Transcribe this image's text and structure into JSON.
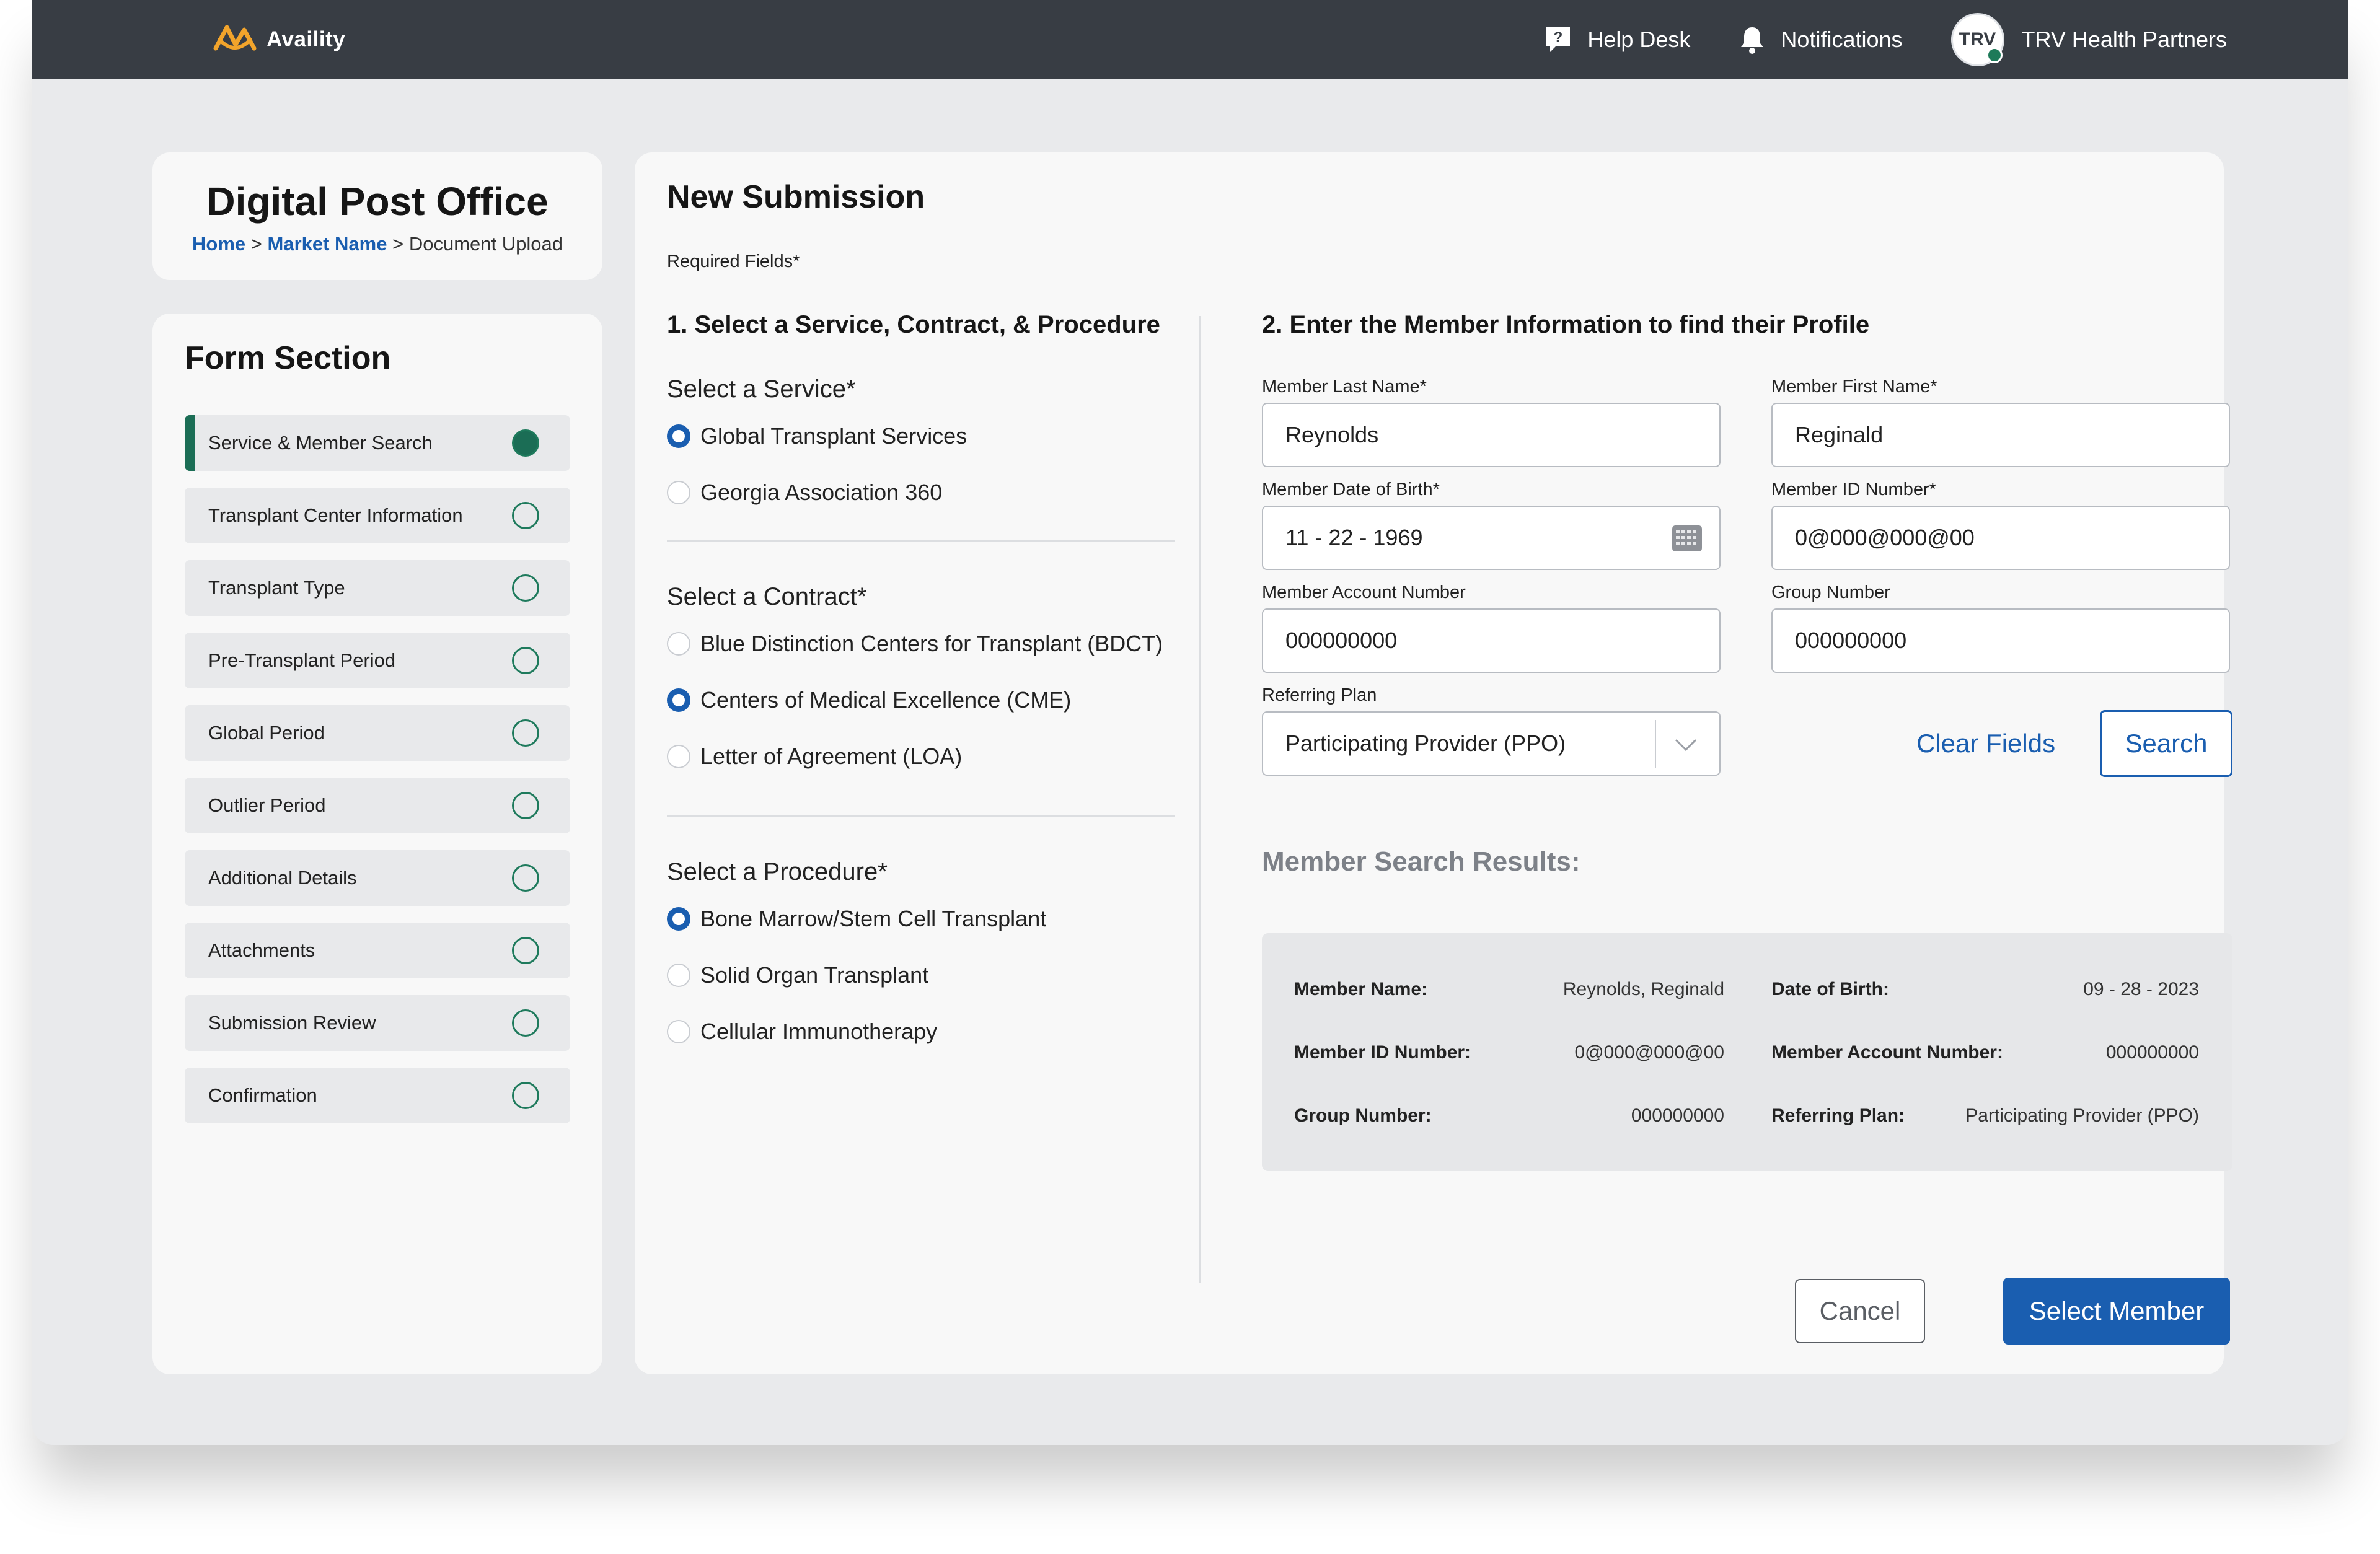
{
  "header": {
    "brand": "Availity",
    "help_desk": "Help Desk",
    "notifications": "Notifications",
    "avatar_initials": "TRV",
    "org_name": "TRV Health Partners"
  },
  "title_card": {
    "title": "Digital Post Office",
    "breadcrumb": {
      "home": "Home",
      "market": "Market Name",
      "current": "Document Upload",
      "separator": ">"
    }
  },
  "sidebar": {
    "title": "Form Section",
    "steps": [
      {
        "label": "Service & Member Search",
        "active": true
      },
      {
        "label": "Transplant Center Information"
      },
      {
        "label": "Transplant Type"
      },
      {
        "label": "Pre-Transplant Period"
      },
      {
        "label": "Global Period"
      },
      {
        "label": "Outlier Period"
      },
      {
        "label": "Additional Details"
      },
      {
        "label": "Attachments"
      },
      {
        "label": "Submission Review"
      },
      {
        "label": "Confirmation"
      }
    ]
  },
  "main": {
    "title": "New Submission",
    "required_note": "Required Fields*",
    "section1": {
      "heading": "1. Select a Service, Contract, & Procedure",
      "service": {
        "title": "Select a Service*",
        "options": [
          "Global Transplant Services",
          "Georgia Association 360"
        ],
        "selected": 0
      },
      "contract": {
        "title": "Select a Contract*",
        "options": [
          "Blue Distinction Centers for Transplant (BDCT)",
          "Centers of Medical Excellence (CME)",
          "Letter of Agreement (LOA)"
        ],
        "selected": 1
      },
      "procedure": {
        "title": "Select a Procedure*",
        "options": [
          "Bone Marrow/Stem Cell Transplant",
          "Solid Organ Transplant",
          "Cellular Immunotherapy"
        ],
        "selected": 0
      }
    },
    "section2": {
      "heading": "2. Enter the Member Information to find their Profile",
      "last_name": {
        "label": "Member Last Name*",
        "value": "Reynolds"
      },
      "first_name": {
        "label": "Member First Name*",
        "value": "Reginald"
      },
      "dob": {
        "label": "Member Date of Birth*",
        "value": "11 - 22 - 1969"
      },
      "member_id": {
        "label": "Member ID Number*",
        "value": "0@000@000@00"
      },
      "account_number": {
        "label": "Member Account Number",
        "value": "000000000"
      },
      "group_number": {
        "label": "Group Number",
        "value": "000000000"
      },
      "referring_plan": {
        "label": "Referring Plan",
        "value": "Participating Provider (PPO)"
      },
      "clear_label": "Clear Fields",
      "search_label": "Search"
    },
    "results": {
      "title": "Member Search Results:",
      "member_name_label": "Member Name:",
      "member_name": "Reynolds, Reginald",
      "dob_label": "Date of Birth:",
      "dob": "09 - 28 - 2023",
      "member_id_label": "Member ID Number:",
      "member_id": "0@000@000@00",
      "account_label": "Member Account Number:",
      "account": "000000000",
      "group_label": "Group Number:",
      "group": "000000000",
      "plan_label": "Referring Plan:",
      "plan": "Participating Provider (PPO)"
    },
    "cancel_label": "Cancel",
    "select_label": "Select Member"
  },
  "colors": {
    "header_bg": "#383d44",
    "primary": "#1a5eb0",
    "active_step": "#1b6d55",
    "canvas": "#e9eaec"
  },
  "icons": [
    "availity-logo-icon",
    "help-icon",
    "bell-icon",
    "calendar-icon",
    "chevron-down-icon"
  ]
}
